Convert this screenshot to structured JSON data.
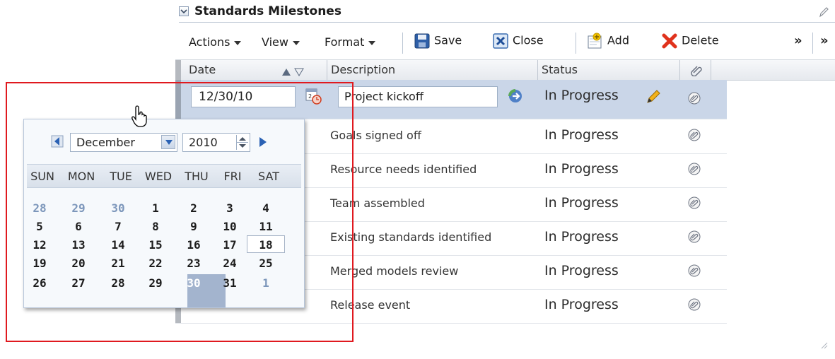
{
  "panel": {
    "title": "Standards Milestones"
  },
  "toolbar": {
    "actions": "Actions",
    "view": "View",
    "format": "Format",
    "save": "Save",
    "close": "Close",
    "add": "Add",
    "delete": "Delete",
    "overflow": "»"
  },
  "table": {
    "columns": [
      "Date",
      "Description",
      "Status"
    ],
    "rows": [
      {
        "date": "12/30/10",
        "description": "Project kickoff",
        "status": "In Progress"
      },
      {
        "description": "Goals signed off",
        "status": "In Progress"
      },
      {
        "description": "Resource needs identified",
        "status": "In Progress"
      },
      {
        "description": "Team assembled",
        "status": "In Progress"
      },
      {
        "description": "Existing standards identified",
        "status": "In Progress"
      },
      {
        "description": "Merged models review",
        "status": "In Progress"
      },
      {
        "description": "Release event",
        "status": "In Progress"
      }
    ]
  },
  "datepicker": {
    "month": "December",
    "year": "2010",
    "weekdays": [
      "SUN",
      "MON",
      "TUE",
      "WED",
      "THU",
      "FRI",
      "SAT"
    ],
    "weeks": [
      [
        "28",
        "29",
        "30",
        "1",
        "2",
        "3",
        "4"
      ],
      [
        "5",
        "6",
        "7",
        "8",
        "9",
        "10",
        "11"
      ],
      [
        "12",
        "13",
        "14",
        "15",
        "16",
        "17",
        "18"
      ],
      [
        "19",
        "20",
        "21",
        "22",
        "23",
        "24",
        "25"
      ],
      [
        "26",
        "27",
        "28",
        "29",
        "30",
        "31",
        "1"
      ]
    ],
    "selected_day": "30",
    "today_day": "18"
  },
  "colors": {
    "selected_row": "#cad6e8",
    "highlight_border": "#e0191f",
    "selected_day": "#a3b4ce",
    "other_month_day": "#7d97bb"
  }
}
